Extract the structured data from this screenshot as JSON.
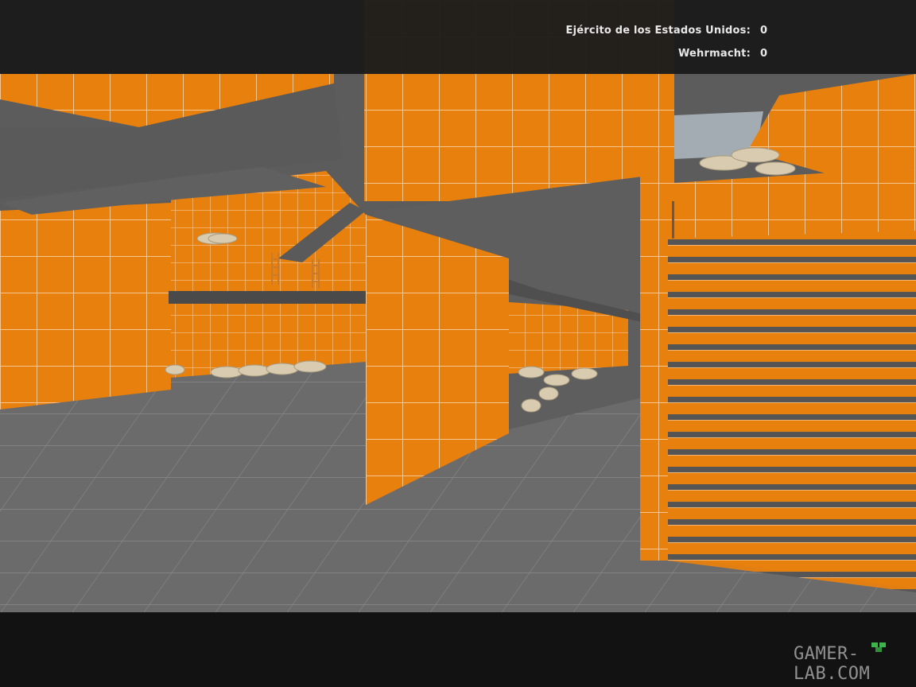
{
  "scoreboard": {
    "teams": [
      {
        "name": "Ejército de los Estados Unidos:",
        "score": "0"
      },
      {
        "name": "Wehrmacht:",
        "score": "0"
      }
    ]
  },
  "watermark": {
    "text": "GAMER-LAB.COM"
  },
  "colors": {
    "wall_orange": "#e8800e",
    "floor_gray": "#6a6a6a",
    "hud_bar": "#141414",
    "grid_line": "#f3c08a"
  }
}
